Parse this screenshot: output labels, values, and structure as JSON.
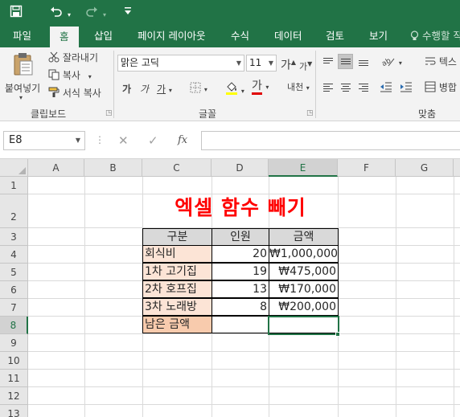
{
  "quick_access": {
    "save_icon": "save-icon",
    "undo_icon": "undo-icon",
    "redo_icon": "redo-icon",
    "customize_icon": "customize-qat-icon"
  },
  "tabs": [
    "파일",
    "홈",
    "삽입",
    "페이지 레이아웃",
    "수식",
    "데이터",
    "검토",
    "보기"
  ],
  "active_tab": "홈",
  "tell_me": "수행할 작",
  "ribbon": {
    "clipboard": {
      "paste_label": "붙여넣기",
      "cut_label": "잘라내기",
      "copy_label": "복사",
      "format_painter_label": "서식 복사",
      "group_label": "클립보드"
    },
    "font": {
      "font_name": "맑은 고딕",
      "font_size": "11",
      "grow_label": "가",
      "shrink_label": "가",
      "bold_label": "가",
      "italic_label": "가",
      "underline_label": "가",
      "font_color_label": "가",
      "phonetic_label": "내천",
      "group_label": "글꼴"
    },
    "alignment": {
      "wrap_text_label": "텍스",
      "merge_label": "병합",
      "group_label": "맞춤"
    }
  },
  "formula_bar": {
    "name_box": "E8",
    "cancel_symbol": "✕",
    "enter_symbol": "✓",
    "fx_symbol": "fx",
    "formula": ""
  },
  "columns": [
    "A",
    "B",
    "C",
    "D",
    "E",
    "F",
    "G"
  ],
  "rows": [
    "1",
    "2",
    "3",
    "4",
    "5",
    "6",
    "7",
    "8",
    "9",
    "10",
    "11",
    "12",
    "13"
  ],
  "selected_cell": {
    "column": "E",
    "row": "8"
  },
  "sheet": {
    "title": "엑셀 함수 빼기",
    "table": {
      "headers": [
        "구분",
        "인원",
        "금액"
      ],
      "rows": [
        {
          "label": "회식비",
          "count": "20",
          "amount": "₩1,000,000"
        },
        {
          "label": "1차 고기집",
          "count": "19",
          "amount": "₩475,000"
        },
        {
          "label": "2차 호프집",
          "count": "13",
          "amount": "₩170,000"
        },
        {
          "label": "3차 노래방",
          "count": "8",
          "amount": "₩200,000"
        },
        {
          "label": "남은 금액",
          "count": "",
          "amount": ""
        }
      ]
    }
  },
  "colors": {
    "accent": "#217346",
    "title_red": "#ff0000",
    "header_fill": "#d9d9d9",
    "label_fill": "#fce4d6",
    "label_fill_dark": "#f8cbad",
    "underline_red": "#e00000",
    "fill_yellow": "#ffff00"
  }
}
